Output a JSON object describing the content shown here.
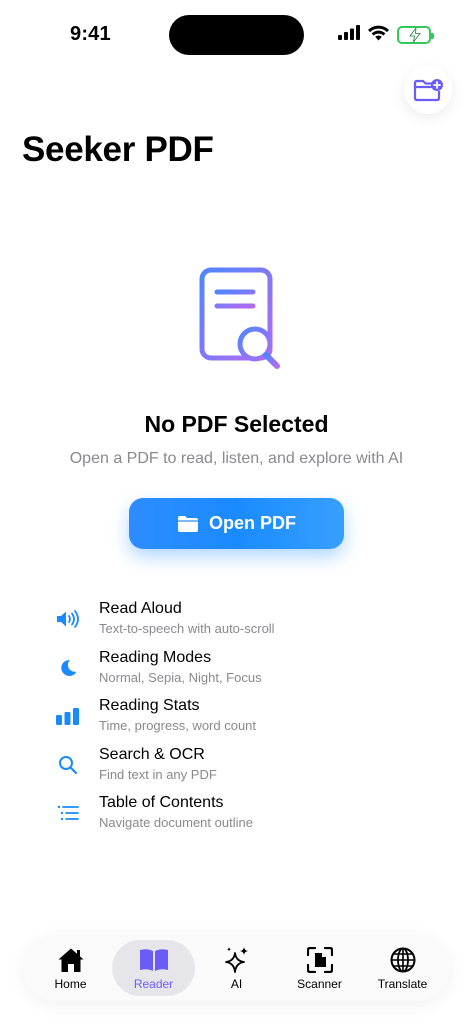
{
  "status_bar": {
    "time": "9:41"
  },
  "header": {
    "title": "Seeker PDF"
  },
  "empty_state": {
    "title": "No PDF Selected",
    "subtitle": "Open a PDF to read, listen, and explore with AI",
    "button_label": "Open PDF"
  },
  "features": [
    {
      "title": "Read Aloud",
      "subtitle": "Text-to-speech with auto-scroll",
      "icon": "speaker-icon"
    },
    {
      "title": "Reading Modes",
      "subtitle": "Normal, Sepia, Night, Focus",
      "icon": "moon-icon"
    },
    {
      "title": "Reading Stats",
      "subtitle": "Time, progress, word count",
      "icon": "bar-chart-icon"
    },
    {
      "title": "Search & OCR",
      "subtitle": "Find text in any PDF",
      "icon": "search-icon"
    },
    {
      "title": "Table of Contents",
      "subtitle": "Navigate document outline",
      "icon": "list-icon"
    }
  ],
  "tabs": [
    {
      "label": "Home",
      "icon": "home-icon",
      "active": false
    },
    {
      "label": "Reader",
      "icon": "book-icon",
      "active": true
    },
    {
      "label": "AI",
      "icon": "sparkles-icon",
      "active": false
    },
    {
      "label": "Scanner",
      "icon": "scanner-icon",
      "active": false
    },
    {
      "label": "Translate",
      "icon": "globe-icon",
      "active": false
    }
  ],
  "colors": {
    "accent": "#1a8bff",
    "active_tab": "#6b5cf5",
    "battery": "#34c759",
    "secondary_text": "#8a8a8e"
  }
}
